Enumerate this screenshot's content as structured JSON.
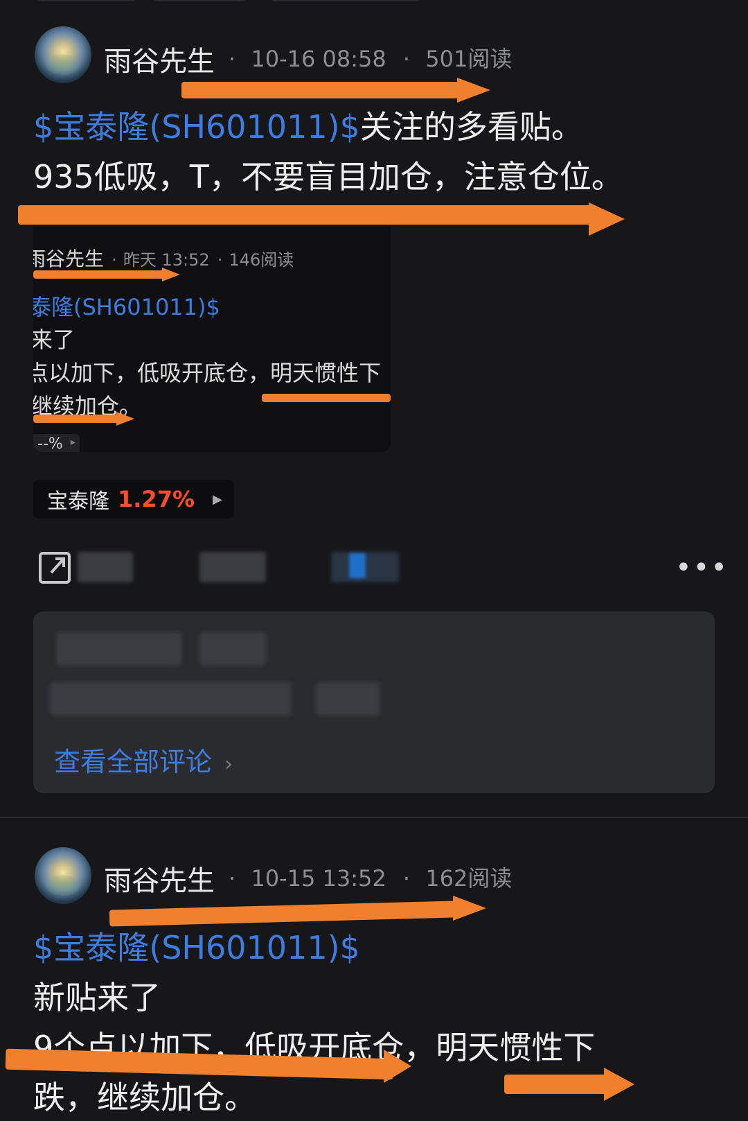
{
  "posts": [
    {
      "author": "雨谷先生",
      "date": "10-16 08:58",
      "reads": "501阅读",
      "stock_link": "$宝泰隆(SH601011)$",
      "line1_rest": "关注的多看贴。",
      "line2": "935低吸，T，不要盲目加仓，注意仓位。"
    },
    {
      "author": "雨谷先生",
      "date": "10-15 13:52",
      "reads": "162阅读",
      "stock_link": "$宝泰隆(SH601011)$",
      "lines": [
        "新贴来了",
        "9个点以加下，低吸开底仓，明天惯性下",
        "跌，继续加仓。"
      ]
    }
  ],
  "quoted_card": {
    "author": "雨谷先生",
    "date": "昨天 13:52",
    "reads": "146阅读",
    "stock_link": "泰隆(SH601011)$",
    "lines": [
      "来了",
      "点以加下，低吸开底仓，明天惯性下",
      "继续加仓。"
    ],
    "pct": "--%"
  },
  "stock_chip": {
    "name": "宝泰隆",
    "change": "1.27%",
    "change_color": "#ff4d2e"
  },
  "comments": {
    "view_all": "查看全部评论"
  },
  "meta_separator": "·",
  "annotation_color": "#f0802e",
  "icons": [
    "share-icon",
    "more-icon",
    "chevron-right-icon",
    "play-arrow-icon"
  ]
}
